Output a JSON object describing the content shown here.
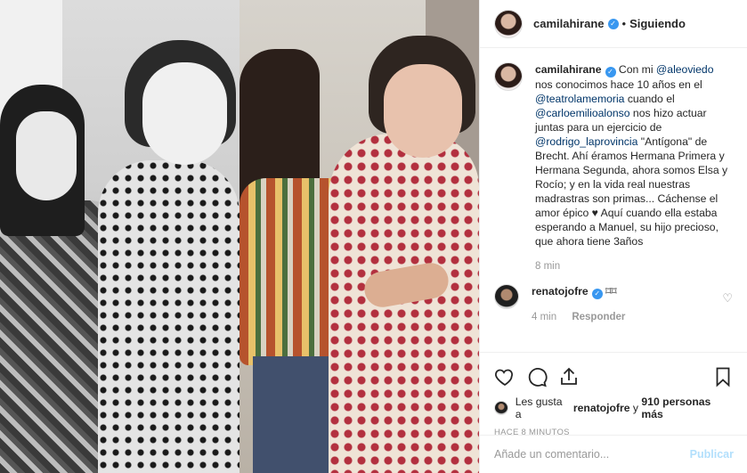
{
  "post": {
    "image_alt": "Two side-by-side photos of two women, one pregnant"
  },
  "header": {
    "username": "camilahirane",
    "separator": "•",
    "follow_status": "Siguiendo"
  },
  "caption": {
    "username": "camilahirane",
    "text_1": " Con mi ",
    "mention_1": "@aleoviedo",
    "text_2": " nos conocimos hace 10 años en el ",
    "mention_2": "@teatrolamemoria",
    "text_3": " cuando el ",
    "mention_3": "@carloemilioalonso",
    "text_4": " nos hizo actuar juntas para un ejercicio de ",
    "mention_4": "@rodrigo_laprovincia",
    "text_5": " \"Antígona\" de Brecht. Ahí éramos Hermana Primera y Hermana Segunda, ahora somos Elsa y Rocío; y en la vida real nuestras madrastras son primas... Cáchense el amor épico ♥ Aquí cuando ella estaba esperando a Manuel, su hijo precioso, que ahora tiene 3años",
    "time": "8 min"
  },
  "reply": {
    "username": "renatojofre",
    "text": "⌑⌑",
    "time": "4 min",
    "reply_label": "Responder"
  },
  "likes": {
    "prefix": "Les gusta a ",
    "user": "renatojofre",
    "middle": " y ",
    "count": "910 personas más"
  },
  "time_ago": "HACE 8 MINUTOS",
  "comment_box": {
    "placeholder": "Añade un comentario...",
    "post_label": "Publicar"
  },
  "icons": {
    "like": "heart-icon",
    "comment": "comment-icon",
    "share": "share-icon",
    "save": "bookmark-icon"
  }
}
